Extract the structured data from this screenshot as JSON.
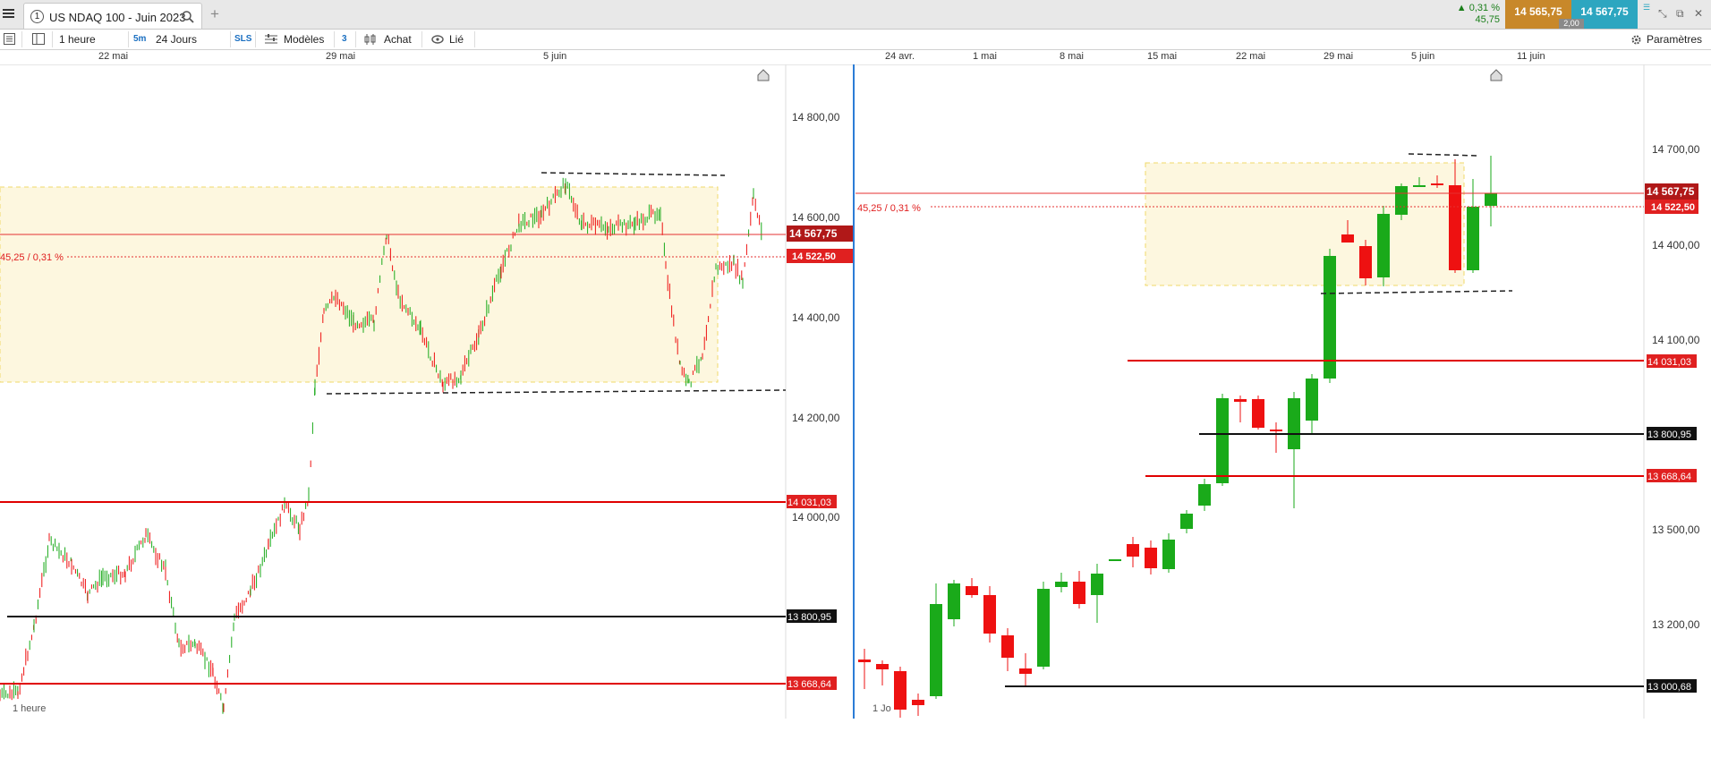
{
  "window": {
    "tab_number": "1",
    "tab_title": "US NDAQ 100 - Juin 2023",
    "change_pct": "▲ 0,31 %",
    "change_abs": "45,75",
    "bid": "14 565,75",
    "ask": "14 567,75",
    "spread": "2,00"
  },
  "toolbar": {
    "interval": "1 heure",
    "sub_interval": "5m",
    "range": "24 Jours",
    "sls": "SLS",
    "models": "Modèles",
    "count": "3",
    "buy": "Achat",
    "linked": "Lié",
    "settings": "Paramètres"
  },
  "left_chart": {
    "timeframe_label": "1 heure",
    "date_labels": [
      "22 mai",
      "29 mai",
      "5 juin"
    ],
    "price_labels": [
      "14 800,00",
      "14 600,00",
      "14 400,00",
      "14 200,00",
      "14 000,00"
    ],
    "current_price": "14 567,75",
    "prev_close": "14 522,50",
    "change_text": "45,25 / 0,31 %",
    "level_red_1": "14 031,03",
    "level_black": "13 800,95",
    "level_red_2": "13 668,64"
  },
  "right_chart": {
    "timeframe_label": "1 Jo",
    "date_labels": [
      "24 avr.",
      "1 mai",
      "8 mai",
      "15 mai",
      "22 mai",
      "29 mai",
      "5 juin",
      "11 juin"
    ],
    "price_labels": [
      "14 700,00",
      "14 400,00",
      "14 100,00",
      "13 500,00",
      "13 200,00"
    ],
    "current_price": "14 567,75",
    "prev_close": "14 522,50",
    "change_text": "45,25 / 0,31 %",
    "level_red_1": "14 031,03",
    "level_black_1": "13 800,95",
    "level_red_2": "13 668,64",
    "level_black_2": "13 000,68"
  },
  "colors": {
    "up": "#1aaa1a",
    "down": "#ee1111",
    "level": "#e00000",
    "zone": "#fdf7df"
  }
}
